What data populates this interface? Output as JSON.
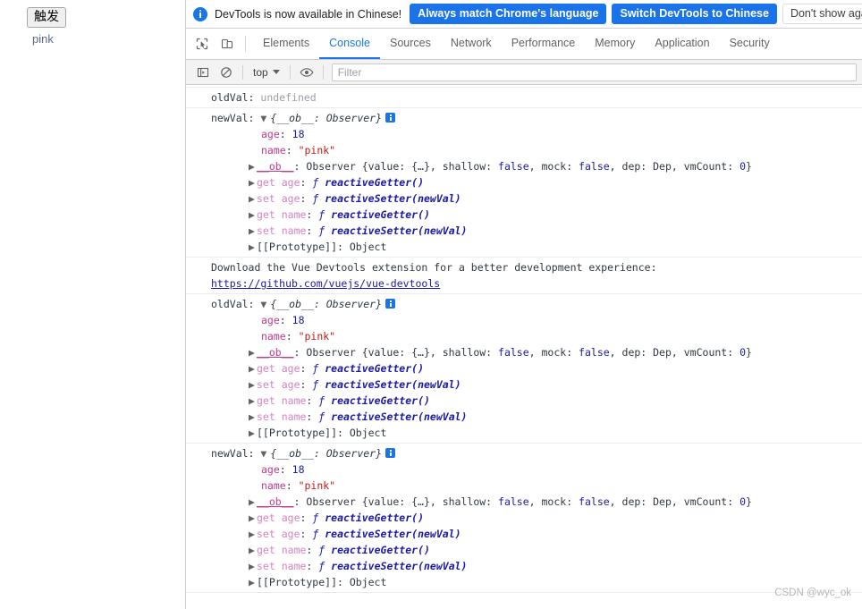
{
  "page": {
    "trigger_button_label": "触发",
    "bound_value_label": "pink"
  },
  "devtools": {
    "infobar": {
      "message": "DevTools is now available in Chinese!",
      "buttons": [
        {
          "label": "Always match Chrome's language",
          "style": "primary"
        },
        {
          "label": "Switch DevTools to Chinese",
          "style": "primary"
        },
        {
          "label": "Don't show again",
          "style": "secondary"
        }
      ],
      "icon": "info-circle-icon"
    },
    "tabs": [
      {
        "label": "Elements",
        "active": false
      },
      {
        "label": "Console",
        "active": true
      },
      {
        "label": "Sources",
        "active": false
      },
      {
        "label": "Network",
        "active": false
      },
      {
        "label": "Performance",
        "active": false
      },
      {
        "label": "Memory",
        "active": false
      },
      {
        "label": "Application",
        "active": false
      },
      {
        "label": "Security",
        "active": false
      }
    ],
    "toolbar_icons": [
      {
        "name": "inspect-element-icon"
      },
      {
        "name": "device-toolbar-icon"
      }
    ],
    "console_toolbar": {
      "sidebar_icon": "console-sidebar-icon",
      "clear_icon": "clear-console-icon",
      "context_label": "top",
      "eye_icon": "live-expression-icon",
      "filter_placeholder": "Filter"
    }
  },
  "console": {
    "groups": [
      {
        "id": "group-1",
        "kind": "simple",
        "label": "oldVal:",
        "value": "undefined"
      },
      {
        "id": "group-2",
        "kind": "object",
        "label": "newVal:",
        "summary": "{__ob__: Observer}",
        "props": [
          {
            "key": "age",
            "value": "18",
            "type": "number"
          },
          {
            "key": "name",
            "value": "\"pink\"",
            "type": "string"
          }
        ],
        "observer_line": {
          "key": "__ob__",
          "prefix": ": Observer {value: {…}, shallow: ",
          "shallow": "false",
          "mid": ", mock: ",
          "mock": "false",
          "suffix": ", dep: Dep, vmCount: ",
          "vmcount": "0",
          "end": "}"
        },
        "accessors": [
          {
            "kind": "get",
            "key": "age",
            "fn": "reactiveGetter()"
          },
          {
            "kind": "set",
            "key": "age",
            "fn": "reactiveSetter(newVal)"
          },
          {
            "kind": "get",
            "key": "name",
            "fn": "reactiveGetter()"
          },
          {
            "kind": "set",
            "key": "name",
            "fn": "reactiveSetter(newVal)"
          }
        ],
        "prototype": "[[Prototype]]: Object"
      },
      {
        "id": "group-3",
        "kind": "vue-devtools",
        "message": "Download the Vue Devtools extension for a better development experience:",
        "link": "https://github.com/vuejs/vue-devtools"
      },
      {
        "id": "group-4",
        "kind": "object",
        "label": "oldVal:",
        "summary": "{__ob__: Observer}",
        "props": [
          {
            "key": "age",
            "value": "18",
            "type": "number"
          },
          {
            "key": "name",
            "value": "\"pink\"",
            "type": "string"
          }
        ],
        "observer_line": {
          "key": "__ob__",
          "prefix": ": Observer {value: {…}, shallow: ",
          "shallow": "false",
          "mid": ", mock: ",
          "mock": "false",
          "suffix": ", dep: Dep, vmCount: ",
          "vmcount": "0",
          "end": "}"
        },
        "accessors": [
          {
            "kind": "get",
            "key": "age",
            "fn": "reactiveGetter()"
          },
          {
            "kind": "set",
            "key": "age",
            "fn": "reactiveSetter(newVal)"
          },
          {
            "kind": "get",
            "key": "name",
            "fn": "reactiveGetter()"
          },
          {
            "kind": "set",
            "key": "name",
            "fn": "reactiveSetter(newVal)"
          }
        ],
        "prototype": "[[Prototype]]: Object"
      },
      {
        "id": "group-5",
        "kind": "object",
        "label": "newVal:",
        "summary": "{__ob__: Observer}",
        "props": [
          {
            "key": "age",
            "value": "18",
            "type": "number"
          },
          {
            "key": "name",
            "value": "\"pink\"",
            "type": "string"
          }
        ],
        "observer_line": {
          "key": "__ob__",
          "prefix": ": Observer {value: {…}, shallow: ",
          "shallow": "false",
          "mid": ", mock: ",
          "mock": "false",
          "suffix": ", dep: Dep, vmCount: ",
          "vmcount": "0",
          "end": "}"
        },
        "accessors": [
          {
            "kind": "get",
            "key": "age",
            "fn": "reactiveGetter()"
          },
          {
            "kind": "set",
            "key": "age",
            "fn": "reactiveSetter(newVal)"
          },
          {
            "kind": "get",
            "key": "name",
            "fn": "reactiveGetter()"
          },
          {
            "kind": "set",
            "key": "name",
            "fn": "reactiveSetter(newVal)"
          }
        ],
        "prototype": "[[Prototype]]: Object"
      }
    ]
  },
  "watermark": "CSDN @wyc_ok",
  "colors": {
    "accent": "#1a73e8",
    "string": "#c41a16",
    "number": "#1a1aa6",
    "property": "#c13a8a",
    "muted": "#9aa0a6"
  }
}
